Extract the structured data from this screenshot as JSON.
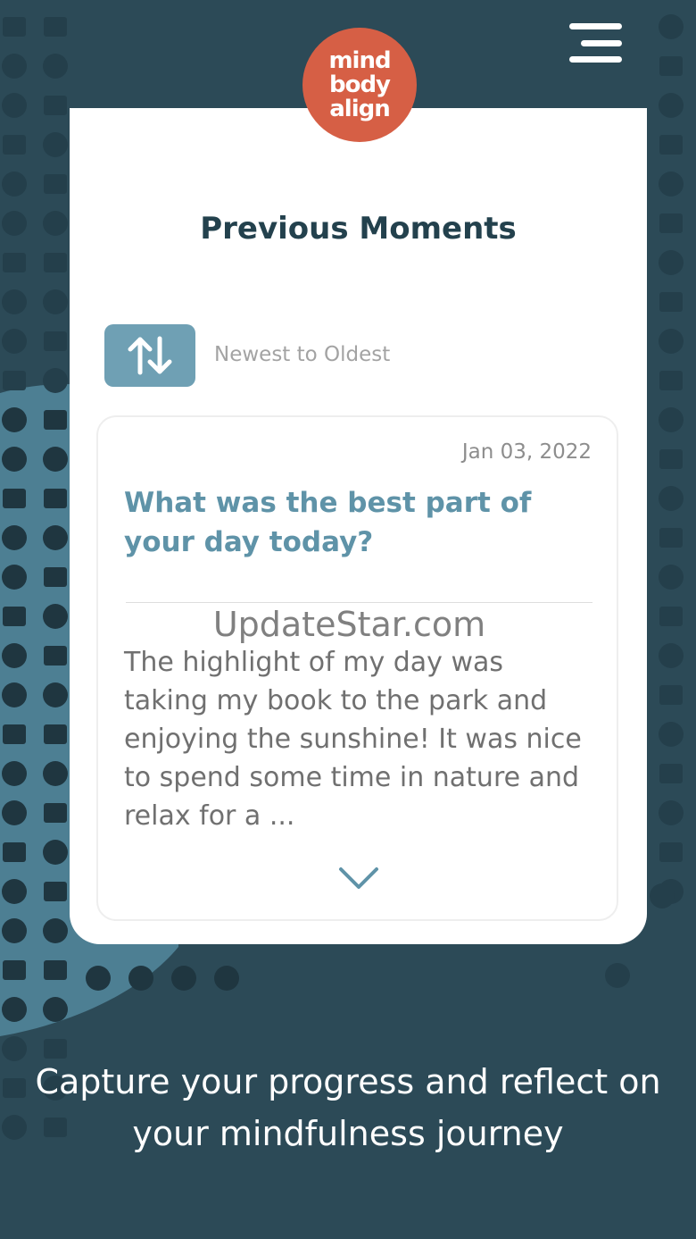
{
  "app": {
    "name": "mind body align"
  },
  "header": {
    "logo_lines": [
      "mind",
      "body",
      "align"
    ],
    "menu_icon": "hamburger-menu-icon"
  },
  "main": {
    "title": "Previous Moments",
    "sort": {
      "icon": "sort-arrows-icon",
      "label": "Newest to Oldest"
    },
    "entries": [
      {
        "date": "Jan 03, 2022",
        "question": "What was the best part of your day today?",
        "body": "The highlight of my day was taking my book to the park and enjoying the sunshine! It was nice to spend some time in nature and relax for a ...",
        "expand_icon": "chevron-down-icon"
      }
    ]
  },
  "watermark": "UpdateStar.com",
  "tagline": "Capture your progress and reflect on your mindfulness journey",
  "colors": {
    "background": "#2c4a57",
    "accent": "#d65f45",
    "sort_button": "#6fa0b4",
    "question_text": "#5f93a8",
    "title_text": "#23414d"
  }
}
